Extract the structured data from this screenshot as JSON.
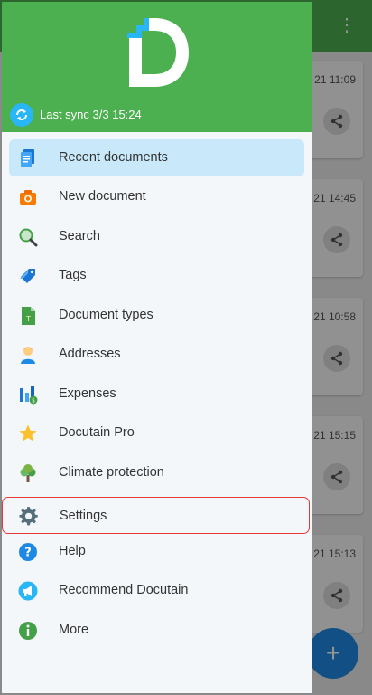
{
  "drawer": {
    "sync_text": "Last sync 3/3 15:24",
    "active_item": "Recent documents",
    "items": [
      {
        "label": "Recent documents",
        "icon": "documents-icon"
      },
      {
        "label": "New document",
        "icon": "camera-icon"
      },
      {
        "label": "Search",
        "icon": "search-icon"
      },
      {
        "label": "Tags",
        "icon": "tag-icon"
      },
      {
        "label": "Document types",
        "icon": "document-type-icon"
      },
      {
        "label": "Addresses",
        "icon": "person-icon"
      },
      {
        "label": "Expenses",
        "icon": "expenses-icon"
      },
      {
        "label": "Docutain Pro",
        "icon": "star-icon"
      },
      {
        "label": "Climate protection",
        "icon": "tree-icon"
      },
      {
        "label": "Settings",
        "icon": "gear-icon"
      },
      {
        "label": "Help",
        "icon": "help-icon"
      },
      {
        "label": "Recommend Docutain",
        "icon": "megaphone-icon"
      },
      {
        "label": "More",
        "icon": "info-icon"
      }
    ]
  },
  "background": {
    "dates": [
      "21 11:09",
      "21 14:45",
      "21 10:58",
      "21 15:15",
      "21 15:13"
    ]
  },
  "colors": {
    "brand_green": "#4caf50",
    "highlight": "#c9e9fb",
    "selection_outline": "#e53935",
    "fab_blue": "#1e88e5"
  }
}
